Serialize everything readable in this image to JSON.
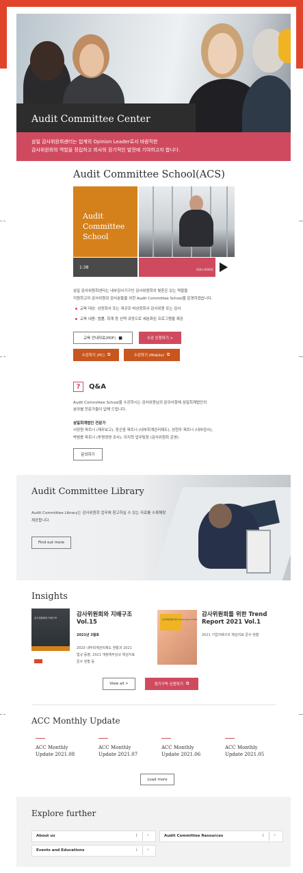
{
  "hero": {
    "title": "Audit Committee Center",
    "band_lines": [
      "삼일 감사위원회센터는 업계의 Opinion Leader로서 바람직한",
      "감사위원회의 역할을 정립하고 회사의 장기적인 발전에 기여하고자 합니다."
    ]
  },
  "acs": {
    "title": "Audit Committee School(ACS)",
    "tile_lines": [
      "Audit",
      "Committee",
      "School"
    ],
    "video_time": "1:38",
    "video_label": "SOLI-HOOD",
    "desc_lines": [
      "삼일 감사위원회센터는 내부감사기구인 감사위원회의 빛흔은 있는 역할을",
      "지원하고자 감사위원과 감사분들을 위한 Audit Committee School을 운영하겠습니다."
    ],
    "bullets": [
      "교육 대상: 상장회사 또는 대규모 비상장회사 감사위원 또는 감사",
      "교육 내용: 법률, 회계 등 선택 과정으로 세분화된 프로그램을 제공"
    ],
    "buttons": {
      "guide": "교육 안내자료(PDF)",
      "apply": "수강 신청하기 >",
      "pc": "수강하기 (PC)",
      "mobile": "수강하기 (Mobile)"
    }
  },
  "qa": {
    "title": "Q&A",
    "intro_lines": [
      "Audit Committee School을 수강하시는 감사위원님의 문의사항에 삼일회계법인의",
      "분야별 전문가들이 답해 드립니다."
    ],
    "experts_title": "삼일회계법인 전문가",
    "expert_lines": [
      "서정원 파트너 (재무보고), 장군중 파트너 (내부회계관리제도), 성현주 파트너 (내부감사),",
      "박범용 파트너 (투명경영 조사), 이지혁 업무팀장 (감사위원회 운영)"
    ],
    "button": "문의하기"
  },
  "library": {
    "title": "Audit Committee Library",
    "desc_lines": [
      "Audit Committee Library는 감사위원회 업무에 참고하실 수 있는 자료를 수록해왔",
      "제공합니다."
    ],
    "button": "Find out more"
  },
  "insights": {
    "title": "Insights",
    "book1_label": "감사위원회와 지배구조",
    "item1": {
      "title_lines": [
        "감사위원회와 지배구조",
        "Vol.15"
      ],
      "date": "2021년 3월호",
      "desc_lines": [
        "2020 내부회계관리제도 현황과 2021",
        "법규 동향, 2021 개정재무상규 핵심지표",
        "준수 현황 등"
      ]
    },
    "book2_label": "감사위원회를 위한 Trend Report 2021",
    "item2": {
      "title_lines": [
        "감사위원회를 위한 Trend",
        "Report 2021 Vol.1"
      ],
      "desc": "2021 기업지배구조 핵심지표 준수 현황"
    },
    "buttons": {
      "view_all": "View all >",
      "subscribe": "정기구독 신청하기"
    }
  },
  "acc": {
    "title": "ACC Monthly Update",
    "items": [
      {
        "line1": "ACC Monthly",
        "line2": "Update 2021.08"
      },
      {
        "line1": "ACC Monthly",
        "line2": "Update 2021.07"
      },
      {
        "line1": "ACC Monthly",
        "line2": "Update 2021.06"
      },
      {
        "line1": "ACC Monthly",
        "line2": "Update 2021.05"
      }
    ],
    "load_more": "Load more"
  },
  "explore": {
    "title": "Explore further",
    "rows": [
      {
        "label": "About us"
      },
      {
        "label": "Audit Committee Resources"
      },
      {
        "label": "Events and Educations"
      }
    ]
  },
  "colors": {
    "brand_orange": "#e0452b",
    "accent_red": "#d04a5f",
    "acs_orange": "#d5811b",
    "dark_text": "#2d2d2d"
  },
  "icons": {
    "pdf": "film-icon",
    "external": "external-link-icon",
    "info": "info-icon",
    "chevron": "chevron-right-icon",
    "play": "play-icon"
  }
}
